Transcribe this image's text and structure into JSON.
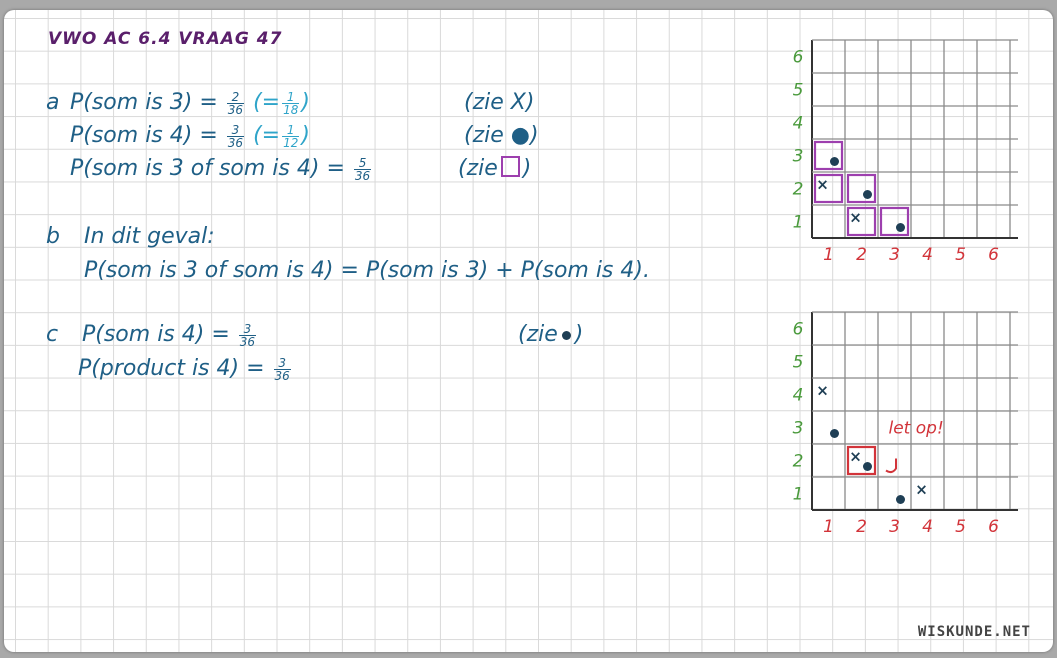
{
  "title": "VWO AC 6.4 VRAAG 47",
  "logo": "WISKUNDE.NET",
  "colors": {
    "ink": "#1f5f86",
    "accent_light": "#2fa4c9",
    "purple": "#9d3fae",
    "red": "#d2343a",
    "green": "#4a9a3c",
    "dot": "#1f3f55"
  },
  "part_a": {
    "label": "a",
    "line1": {
      "lhs": "P(som is 3) =",
      "num": "2",
      "den": "36",
      "eq": "(=",
      "snum": "1",
      "sden": "18",
      "close": ")",
      "note": "(zie X)"
    },
    "line2": {
      "lhs": "P(som is 4) =",
      "num": "3",
      "den": "36",
      "eq": "(=",
      "snum": "1",
      "sden": "12",
      "close": ")",
      "note": "(zie ●)"
    },
    "line3": {
      "lhs": "P(som is 3 of som is 4) =",
      "num": "5",
      "den": "36",
      "note_open": "(zie",
      "note_close": ")"
    }
  },
  "part_b": {
    "label": "b",
    "line1": "In dit geval:",
    "line2": "P(som is 3 of som is 4) = P(som is 3) + P(som is 4)."
  },
  "part_c": {
    "label": "c",
    "line1": {
      "lhs": "P(som is 4) =",
      "num": "3",
      "den": "36",
      "note_open": "(zie",
      "note_close": ")"
    },
    "line2": {
      "lhs": "P(product is 4) =",
      "num": "3",
      "den": "36"
    }
  },
  "grid_top": {
    "x_ticks": [
      "1",
      "2",
      "3",
      "4",
      "5",
      "6"
    ],
    "y_ticks": [
      "1",
      "2",
      "3",
      "4",
      "5",
      "6"
    ],
    "crosses": [
      [
        1,
        2
      ],
      [
        2,
        1
      ]
    ],
    "dots": [
      [
        1,
        3
      ],
      [
        2,
        2
      ],
      [
        3,
        1
      ]
    ],
    "boxes": [
      [
        1,
        3
      ],
      [
        1,
        2
      ],
      [
        2,
        2
      ],
      [
        2,
        1
      ],
      [
        3,
        1
      ]
    ]
  },
  "grid_bottom": {
    "x_ticks": [
      "1",
      "2",
      "3",
      "4",
      "5",
      "6"
    ],
    "y_ticks": [
      "1",
      "2",
      "3",
      "4",
      "5",
      "6"
    ],
    "crosses": [
      [
        1,
        4
      ],
      [
        2,
        2
      ],
      [
        4,
        1
      ]
    ],
    "dots": [
      [
        1,
        3
      ],
      [
        2,
        2
      ],
      [
        3,
        1
      ]
    ],
    "boxes": [
      [
        2,
        2
      ]
    ],
    "annotation": "let op!"
  }
}
